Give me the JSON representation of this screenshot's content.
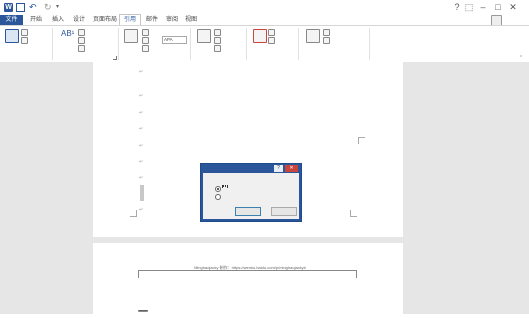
{
  "window": {
    "title": "",
    "logo_letter": "W",
    "help": "?",
    "ribbon_options": "⬚",
    "minimize": "–",
    "maximize": "□",
    "close": "✕",
    "username": "",
    "accent": "#2b579a"
  },
  "quick_access": {
    "undo": "↶",
    "redo": "↻",
    "customize": "▾"
  },
  "tabs": {
    "file": "文件",
    "home": "开始",
    "insert": "插入",
    "design": "设计",
    "layout": "页面布局",
    "references": "引用",
    "mailings": "邮件",
    "review": "审阅",
    "view": "视图"
  },
  "ribbon": {
    "toc": {
      "big": "",
      "add_text": "",
      "update": ""
    },
    "footnotes": {
      "big": "",
      "insert_endnote": "",
      "next": "",
      "show": ""
    },
    "citations": {
      "big": "",
      "manage": "",
      "style_label": "",
      "style_value": "APA",
      "bibliography": ""
    },
    "captions": {
      "big": "",
      "insert_table_fig": "",
      "update_table": "",
      "cross_ref": ""
    },
    "index": {
      "big": "",
      "insert_index": "",
      "update_index": ""
    },
    "authorities": {
      "big": "",
      "insert_toa": "",
      "update_toa": ""
    },
    "groups": {
      "toc": "",
      "footnotes": "",
      "citations": "",
      "captions": "",
      "index": "",
      "authorities": ""
    },
    "collapse": "⌃"
  },
  "document": {
    "para_mark": "↵",
    "header_text": "Minghaojacky 制作：https://wenku.baidu.com/p/minghaojacky#",
    "heading_char": "一"
  },
  "dialog": {
    "title": "",
    "help": "?",
    "close": "✕",
    "prompt": "",
    "option1": "",
    "option2": "",
    "ok": "",
    "cancel": ""
  }
}
